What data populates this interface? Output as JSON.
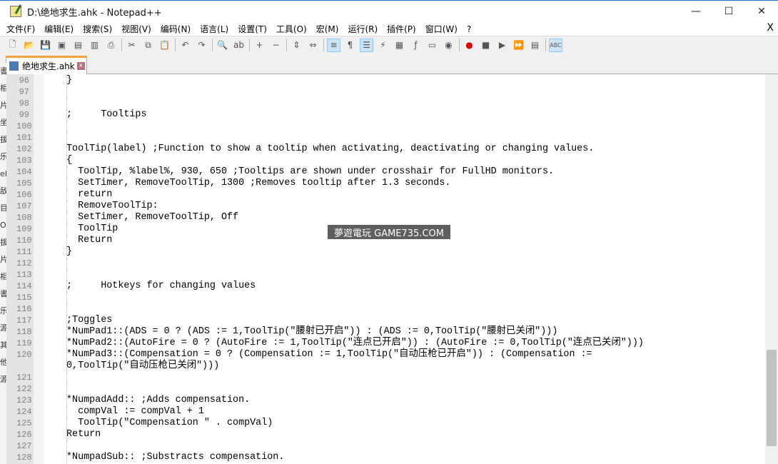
{
  "window": {
    "title": "D:\\绝地求生.ahk - Notepad++",
    "minimize": "—",
    "maximize": "☐",
    "close": "✕"
  },
  "menu": [
    "文件(F)",
    "编辑(E)",
    "搜索(S)",
    "视图(V)",
    "编码(N)",
    "语言(L)",
    "设置(T)",
    "工具(O)",
    "宏(M)",
    "运行(R)",
    "插件(P)",
    "窗口(W)",
    "?"
  ],
  "menu_close": "X",
  "toolbar": [
    "new",
    "open",
    "save",
    "save-all",
    "close",
    "close-all",
    "print",
    "|",
    "cut",
    "copy",
    "paste",
    "|",
    "undo",
    "redo",
    "|",
    "find",
    "replace",
    "|",
    "zoom-in",
    "zoom-out",
    "|",
    "sync-v",
    "sync-h",
    "|",
    "word-wrap",
    "show-all-chars",
    "indent-guide",
    "lang-udl",
    "doc-map",
    "function-list",
    "folder-workspace",
    "monitor",
    "|",
    "record",
    "stop",
    "play",
    "run-multiple",
    "save-macro",
    "|",
    "spellcheck"
  ],
  "tab": {
    "label": "绝地求生.ahk",
    "close": "x"
  },
  "left_strip": "書 相 片 坐 拔 乐 el 敌 目 O 拔 片 相 書 乐 源 其 他 源",
  "watermark": "夢遊電玩 GAME735.COM",
  "lines": [
    {
      "n": "96",
      "t": "}"
    },
    {
      "n": "97",
      "t": ""
    },
    {
      "n": "98",
      "t": ""
    },
    {
      "n": "99",
      "t": ";     Tooltips"
    },
    {
      "n": "100",
      "t": ""
    },
    {
      "n": "101",
      "t": ""
    },
    {
      "n": "102",
      "t": "ToolTip(label) ;Function to show a tooltip when activating, deactivating or changing values."
    },
    {
      "n": "103",
      "t": "{"
    },
    {
      "n": "104",
      "t": "  ToolTip, %label%, 930, 650 ;Tooltips are shown under crosshair for FullHD monitors."
    },
    {
      "n": "105",
      "t": "  SetTimer, RemoveToolTip, 1300 ;Removes tooltip after 1.3 seconds."
    },
    {
      "n": "106",
      "t": "  return"
    },
    {
      "n": "107",
      "t": "  RemoveToolTip:"
    },
    {
      "n": "108",
      "t": "  SetTimer, RemoveToolTip, Off"
    },
    {
      "n": "109",
      "t": "  ToolTip"
    },
    {
      "n": "110",
      "t": "  Return"
    },
    {
      "n": "111",
      "t": "}"
    },
    {
      "n": "112",
      "t": ""
    },
    {
      "n": "113",
      "t": ""
    },
    {
      "n": "114",
      "t": ";     Hotkeys for changing values"
    },
    {
      "n": "115",
      "t": ""
    },
    {
      "n": "116",
      "t": ""
    },
    {
      "n": "117",
      "t": ";Toggles"
    },
    {
      "n": "118",
      "t": "*NumPad1::(ADS = 0 ? (ADS := 1,ToolTip(\"腰射已开启\")) : (ADS := 0,ToolTip(\"腰射已关闭\")))"
    },
    {
      "n": "119",
      "t": "*NumPad2::(AutoFire = 0 ? (AutoFire := 1,ToolTip(\"连点已开启\")) : (AutoFire := 0,ToolTip(\"连点已关闭\")))"
    },
    {
      "n": "120",
      "t": "*NumPad3::(Compensation = 0 ? (Compensation := 1,ToolTip(\"自动压枪已开启\")) : (Compensation :="
    },
    {
      "n": "",
      "t": "0,ToolTip(\"自动压枪已关闭\")))"
    },
    {
      "n": "121",
      "t": ""
    },
    {
      "n": "122",
      "t": ""
    },
    {
      "n": "123",
      "t": "*NumpadAdd:: ;Adds compensation."
    },
    {
      "n": "124",
      "t": "  compVal := compVal + 1"
    },
    {
      "n": "125",
      "t": "  ToolTip(\"Compensation \" . compVal)"
    },
    {
      "n": "126",
      "t": "Return"
    },
    {
      "n": "127",
      "t": ""
    },
    {
      "n": "128",
      "t": "*NumpadSub:: ;Substracts compensation."
    }
  ]
}
